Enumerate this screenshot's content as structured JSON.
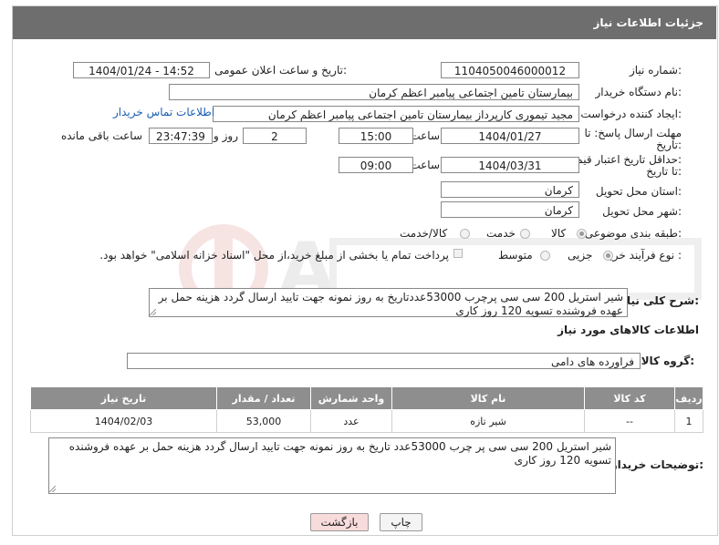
{
  "header": {
    "title": "جزئیات اطلاعات نیاز"
  },
  "form": {
    "need_number_label": "شماره نیاز:",
    "need_number": "1104050046000012",
    "announce_label": "تاریخ و ساعت اعلان عمومی:",
    "announce_value": "1404/01/24 - 14:52",
    "buyer_org_label": "نام دستگاه خریدار:",
    "buyer_org": "بیمارستان تامین اجتماعی پیامبر اعظم کرمان",
    "requester_label": "ایجاد کننده درخواست:",
    "requester": "مجید تیموری کارپرداز بیمارستان تامین اجتماعی پیامبر اعظم کرمان",
    "contact_link": "اطلاعات تماس خریدار",
    "reply_deadline_label_1": "مهلت ارسال پاسخ: تا",
    "reply_deadline_label_2": "تاریخ:",
    "reply_date": "1404/01/27",
    "time_label": "ساعت",
    "reply_time": "15:00",
    "days_value": "2",
    "days_label": "روز و",
    "remaining_time": "23:47:39",
    "remaining_label": "ساعت باقی مانده",
    "price_validity_label_1": "حداقل تاریخ اعتبار قیمت:",
    "price_validity_label_2": "تا تاریخ:",
    "price_date": "1404/03/31",
    "price_time": "09:00",
    "province_label": "استان محل تحویل:",
    "province": "کرمان",
    "city_label": "شهر محل تحویل:",
    "city": "کرمان",
    "category_label": "طبقه بندی موضوعی:",
    "category_options": [
      "کالا",
      "خدمت",
      "کالا/خدمت"
    ],
    "process_label": "نوع فرآیند خرید :",
    "process_options": [
      "جزیی",
      "متوسط"
    ],
    "payment_note": "پرداخت تمام یا بخشی از مبلغ خرید،از محل \"اسناد خزانه اسلامی\" خواهد بود.",
    "description_label": "شرح کلی نیاز:",
    "description": "شیر استریل 200 سی سی پرچرب 53000عددتاریخ به روز نمونه جهت تایید ارسال گردد هزینه حمل بر عهده فروشنده تسویه 120 روز کاری"
  },
  "goods": {
    "section_title": "اطلاعات کالاهای مورد نیاز",
    "group_label": "گروه کالا:",
    "group_value": "فراورده های دامی",
    "columns": [
      "ردیف",
      "کد کالا",
      "نام کالا",
      "واحد شمارش",
      "تعداد / مقدار",
      "تاریخ نیاز"
    ],
    "rows": [
      [
        "1",
        "--",
        "شیر تازه",
        "عدد",
        "53,000",
        "1404/02/03"
      ]
    ]
  },
  "buyer_notes": {
    "label": "توضیحات خریدار:",
    "text": "شیر استریل 200 سی سی پر چرب 53000عدد تاریخ به روز نمونه جهت تایید ارسال گردد هزینه حمل بر عهده فروشنده تسویه 120 روز کاری"
  },
  "buttons": {
    "print": "چاپ",
    "back": "بازگشت"
  },
  "colors": {
    "title_bar": "#6e6e6e",
    "table_header": "#8e8e8e",
    "link": "#1a5fb4",
    "back_button": "#f8dcdc"
  }
}
